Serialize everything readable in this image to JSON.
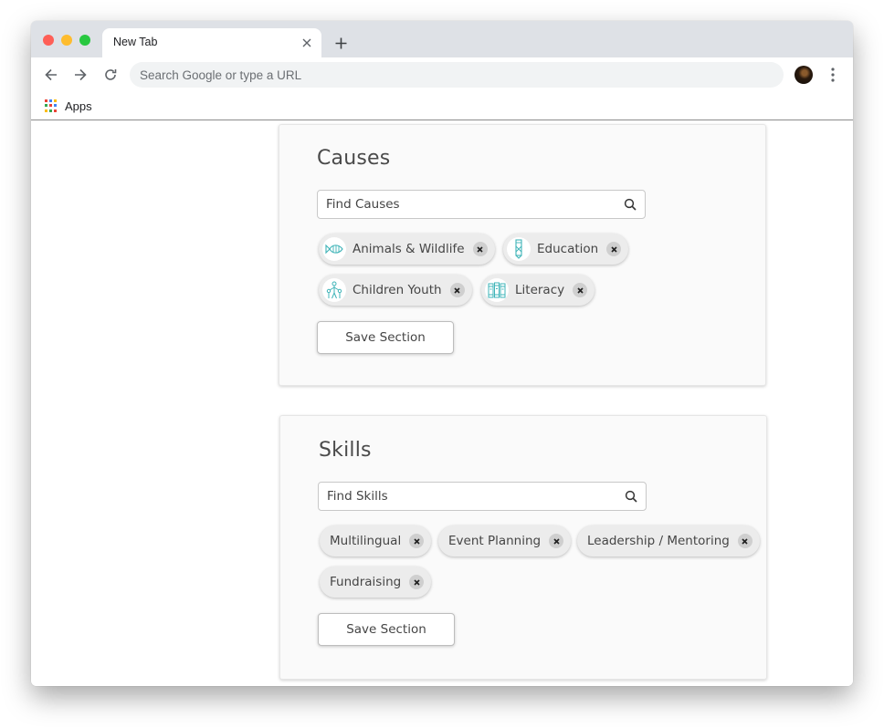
{
  "browser": {
    "tab_title": "New Tab",
    "omnibox_placeholder": "Search Google or type a URL",
    "bookmarks": {
      "apps_label": "Apps"
    },
    "icons": {
      "back": "arrow-left-icon",
      "forward": "arrow-right-icon",
      "reload": "reload-icon",
      "new_tab": "plus-icon",
      "menu": "kebab-menu-icon",
      "apps": "apps-grid-icon"
    }
  },
  "causes": {
    "title": "Causes",
    "search_placeholder": "Find Causes",
    "chips": [
      {
        "label": "Animals & Wildlife",
        "icon": "fish-icon"
      },
      {
        "label": "Education",
        "icon": "pencil-icon"
      },
      {
        "label": "Children Youth",
        "icon": "family-icon"
      },
      {
        "label": "Literacy",
        "icon": "books-icon"
      }
    ],
    "save_label": "Save Section"
  },
  "skills": {
    "title": "Skills",
    "search_placeholder": "Find Skills",
    "chips": [
      {
        "label": "Multilingual"
      },
      {
        "label": "Event Planning"
      },
      {
        "label": "Leadership / Mentoring"
      },
      {
        "label": "Fundraising"
      }
    ],
    "save_label": "Save Section"
  },
  "colors": {
    "chip_icon_accent": "#3fb4b8",
    "tabstrip": "#dee1e6",
    "chip_background": "#ececec"
  }
}
